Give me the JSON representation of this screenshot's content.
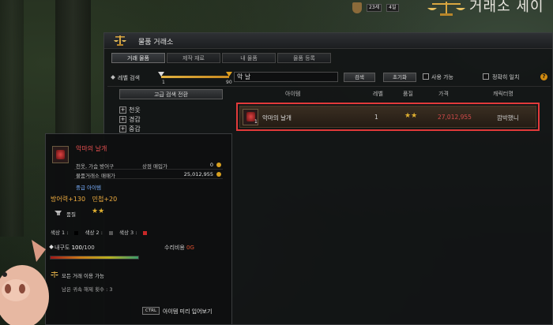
{
  "hud": {
    "stat_a": "23세",
    "stat_b": "4일",
    "title_fragment": "거래소 세이"
  },
  "market": {
    "title": "물품 거래소",
    "tabs": [
      {
        "label": "거래 물품",
        "active": true
      },
      {
        "label": "제작 재료",
        "active": false
      },
      {
        "label": "내 물품",
        "active": false
      },
      {
        "label": "물품 등록",
        "active": false
      }
    ],
    "filters": {
      "level_label": "레벨 검색",
      "level_min": "1",
      "level_max": "90",
      "search_value": "악 날",
      "search_button": "검색",
      "reset_button": "초기화",
      "usable_label": "사용 가능",
      "usable_checked": false,
      "exact_label": "정확히 일치",
      "exact_checked": false,
      "help": "?"
    },
    "categories": {
      "advanced_button": "고급 검색 전환",
      "items": [
        {
          "label": "천옷"
        },
        {
          "label": "경갑"
        },
        {
          "label": "중갑"
        }
      ]
    },
    "results": {
      "headers": {
        "item": "아이템",
        "level": "레벨",
        "quality": "품질",
        "price": "가격",
        "character": "캐릭터명"
      },
      "rows": [
        {
          "name": "악마의 날개",
          "quantity": "1",
          "level": "1",
          "quality": "★★",
          "price": "27,012,955",
          "character": "깜박했니"
        }
      ],
      "highlight_color": "#e23a3a"
    }
  },
  "tooltip": {
    "name": "악마의 날개",
    "table": [
      {
        "k": "천옷, 가슴 방어구",
        "k2": "상점 매입가",
        "v": "0"
      },
      {
        "k": "물품거래소 매매가",
        "k2": "",
        "v": "25,012,955"
      }
    ],
    "grade": "중급 아이템",
    "stats": [
      "방어력+130",
      "민첩+20"
    ],
    "quality_label": "품질",
    "quality_stars": "★★",
    "dyes": [
      {
        "label": "색상 1 :",
        "color": "#000000"
      },
      {
        "label": "색상 2 :",
        "color": "#555555"
      },
      {
        "label": "색상 3 :",
        "color": "#c82828"
      }
    ],
    "durability_label": "내구도",
    "durability_current": "100",
    "durability_max": "/100",
    "durability_fraction": 0.47,
    "repair_label": "수리비용",
    "repair_value": "0G",
    "trade_note": "모든 거래 이용 가능",
    "bind_note": "남은 귀속 해제 횟수 : 3",
    "ctrl_key": "CTRL",
    "ctrl_label": "아이템 미리 입어보기"
  },
  "colors": {
    "accent_gold": "#e0a020",
    "item_red": "#e85050",
    "price_red": "#d24a4a",
    "highlight_red": "#e23a3a"
  },
  "icons": [
    "scale-icon",
    "gem-item-icon",
    "help-icon",
    "coin-icon",
    "plus-icon",
    "pig-mascot"
  ]
}
